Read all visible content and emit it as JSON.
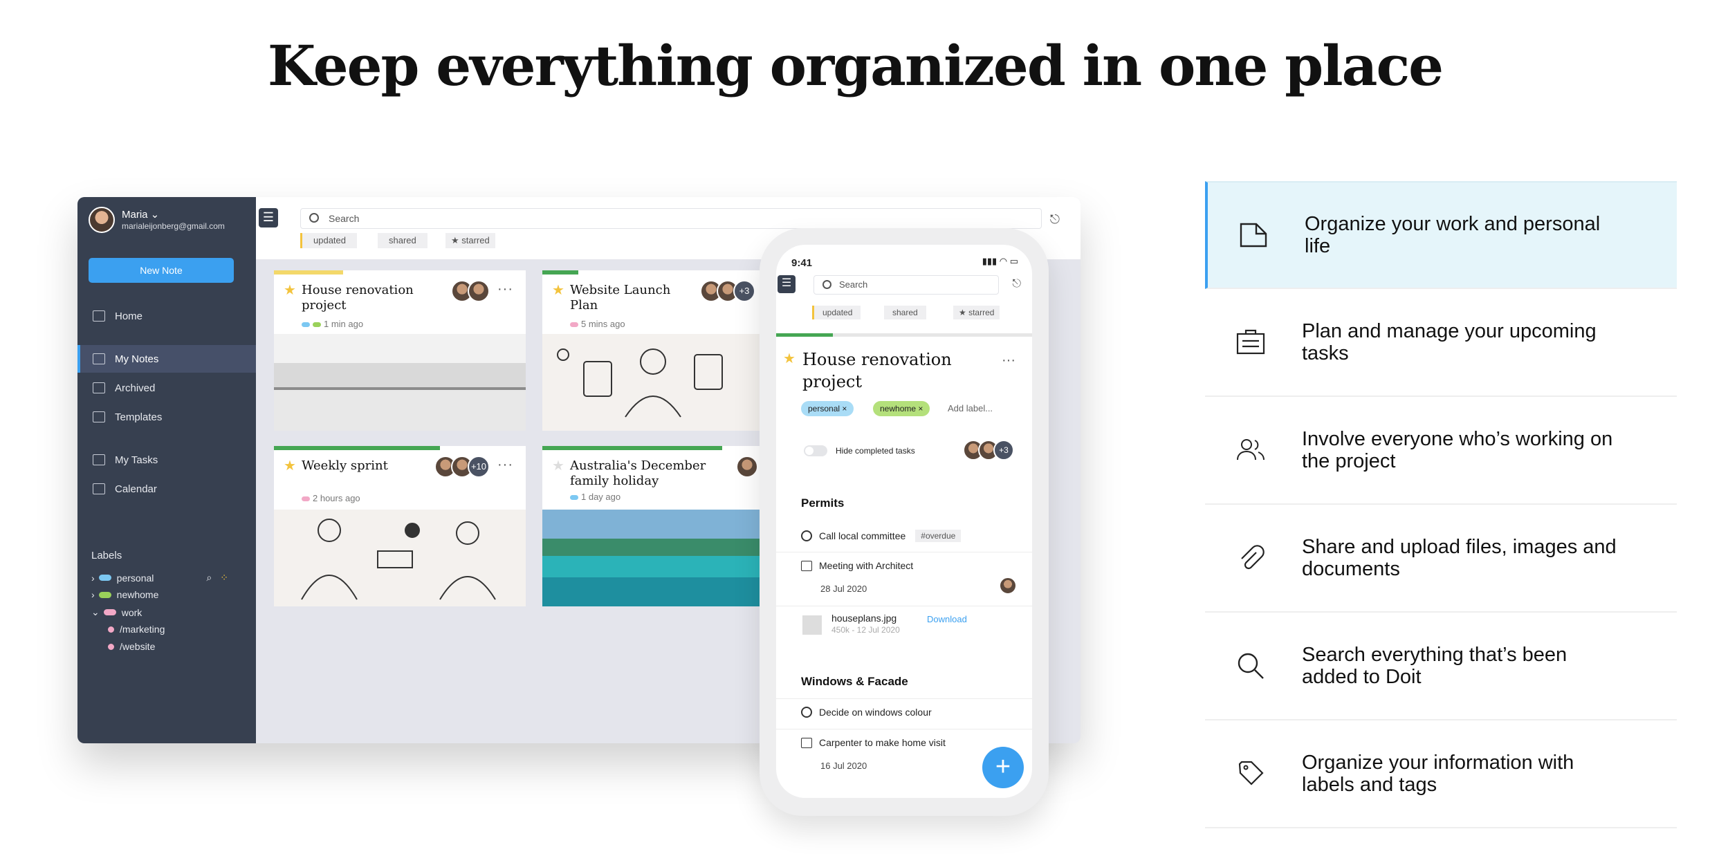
{
  "hero": {
    "title": "Keep everything organized in one place"
  },
  "sidebar": {
    "user_name": "Maria ⌄",
    "user_email": "marialeijonberg@gmail.com",
    "new_note": "New Note",
    "items": [
      {
        "label": "Home",
        "icon": "home-icon"
      },
      {
        "label": "My Notes",
        "icon": "notes-icon",
        "active": true
      },
      {
        "label": "Archived",
        "icon": "archive-icon"
      },
      {
        "label": "Templates",
        "icon": "templates-icon"
      },
      {
        "label": "My Tasks",
        "icon": "tasks-icon"
      },
      {
        "label": "Calendar",
        "icon": "calendar-icon"
      }
    ],
    "labels_heading": "Labels",
    "labels": [
      {
        "name": "personal",
        "color": "#7cc8f2"
      },
      {
        "name": "newhome",
        "color": "#9ad15a"
      },
      {
        "name": "work",
        "color": "#f2a8c6"
      },
      {
        "name": "/marketing",
        "color": "#f2a8c6"
      },
      {
        "name": "/website",
        "color": "#f2a8c6"
      }
    ]
  },
  "toolbar": {
    "search_placeholder": "Search",
    "filters": [
      "updated",
      "shared",
      "★ starred"
    ]
  },
  "cards": [
    {
      "title": "House renovation project",
      "meta": "1 min ago",
      "bar_color": "#f3d86a",
      "bar_fraction": 0.27,
      "starred": true,
      "more": ""
    },
    {
      "title": "Website Launch Plan",
      "meta": "5 mins ago",
      "bar_color": "#45a653",
      "bar_fraction": 0.14,
      "starred": true,
      "more": "+3"
    },
    {
      "title": "Weekly sprint",
      "meta": "2 hours ago",
      "bar_color": "#45a653",
      "bar_fraction": 0.66,
      "starred": true,
      "more": "+10"
    },
    {
      "title": "Australia's December family holiday",
      "meta": "1 day ago",
      "bar_color": "#45a653",
      "bar_fraction": 0.7,
      "starred": false,
      "more": ""
    }
  ],
  "phone": {
    "time": "9:41",
    "search_placeholder": "Search",
    "filters": [
      "updated",
      "shared",
      "★ starred"
    ],
    "note_title": "House renovation project",
    "tags": [
      {
        "name": "personal ×",
        "color": "#a9dcf6"
      },
      {
        "name": "newhome ×",
        "color": "#b4e07b"
      }
    ],
    "add_label": "Add label...",
    "hide_completed": "Hide completed tasks",
    "more_avatars": "+3",
    "sections": [
      {
        "title": "Permits"
      },
      {
        "title": "Windows & Facade"
      }
    ],
    "tasks": {
      "t1": "Call local committee",
      "t1_tag": "#overdue",
      "t2": "Meeting with Architect",
      "t2_date": "28 Jul 2020",
      "file_name": "houseplans.jpg",
      "file_meta": "450k - 12 Jul 2020",
      "download": "Download",
      "t3": "Decide on windows colour",
      "t4": "Carpenter to make home visit",
      "t4_date": "16 Jul 2020"
    },
    "fab": "+"
  },
  "features": [
    {
      "text": "Organize your work and personal life",
      "icon": "note-icon"
    },
    {
      "text": "Plan and manage your upcoming tasks",
      "icon": "briefcase-icon"
    },
    {
      "text": "Involve everyone who’s working on the project",
      "icon": "people-icon"
    },
    {
      "text": "Share and upload files, images and documents",
      "icon": "paperclip-icon"
    },
    {
      "text": "Search everything that’s been added to Doit",
      "icon": "search-icon"
    },
    {
      "text": "Organize your information with labels and tags",
      "icon": "tag-icon"
    }
  ]
}
